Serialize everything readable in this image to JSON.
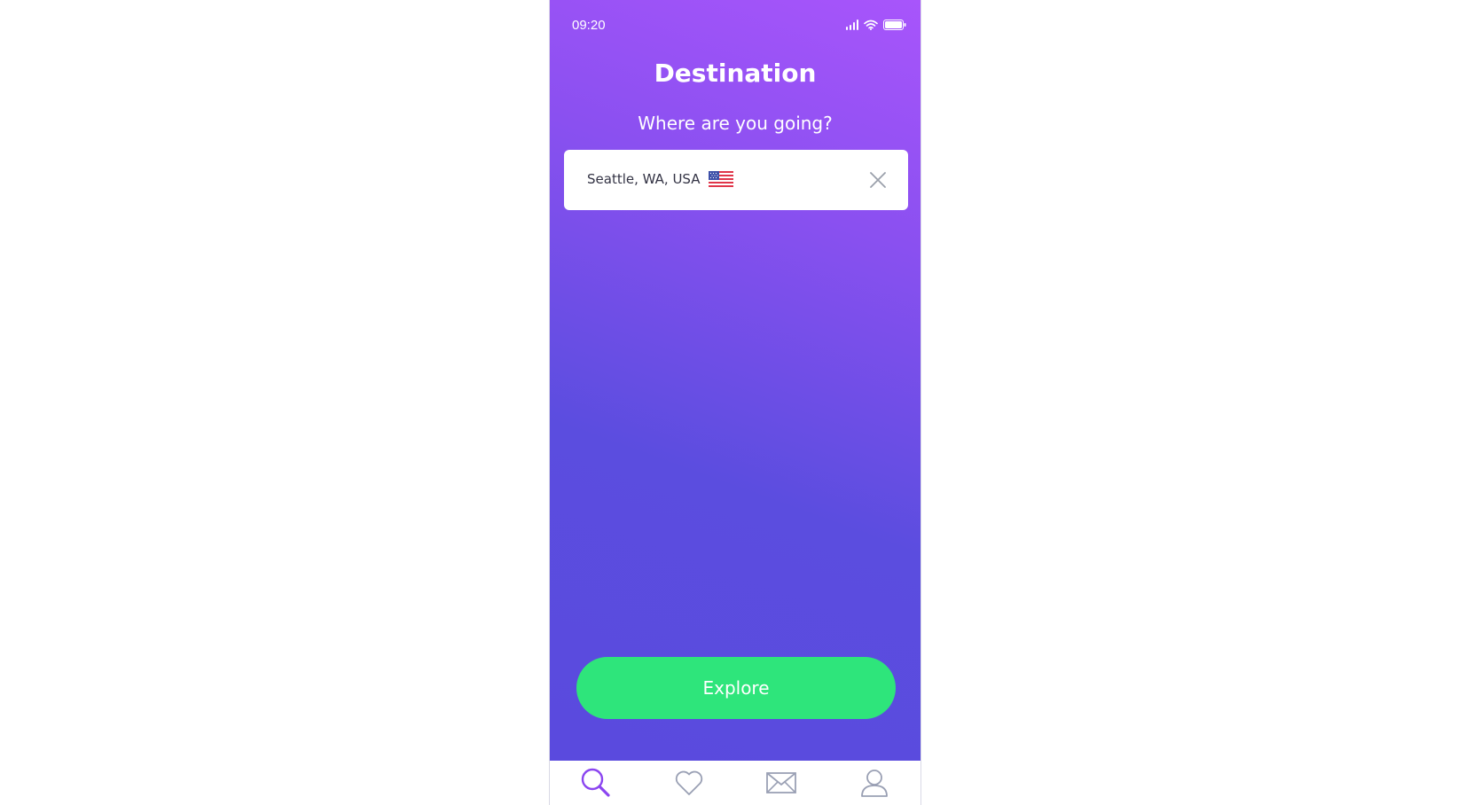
{
  "status_bar": {
    "time": "09:20",
    "icons": [
      "signal-icon",
      "wifi-icon",
      "battery-icon"
    ]
  },
  "header": {
    "title": "Destination",
    "subtitle": "Where are you going?"
  },
  "search": {
    "value": "Seattle, WA, USA",
    "flag_icon": "us-flag-icon",
    "clear_icon": "close-icon"
  },
  "actions": {
    "explore_label": "Explore"
  },
  "tab_bar": {
    "items": [
      {
        "icon": "search-icon",
        "active": true
      },
      {
        "icon": "heart-icon",
        "active": false
      },
      {
        "icon": "mail-icon",
        "active": false
      },
      {
        "icon": "profile-icon",
        "active": false
      }
    ]
  },
  "colors": {
    "gradient_top": "#a855fb",
    "gradient_bottom": "#5a4ade",
    "accent_green": "#2ee57b",
    "active_tab": "#8b45f0",
    "inactive_tab": "#9aa0b4"
  }
}
